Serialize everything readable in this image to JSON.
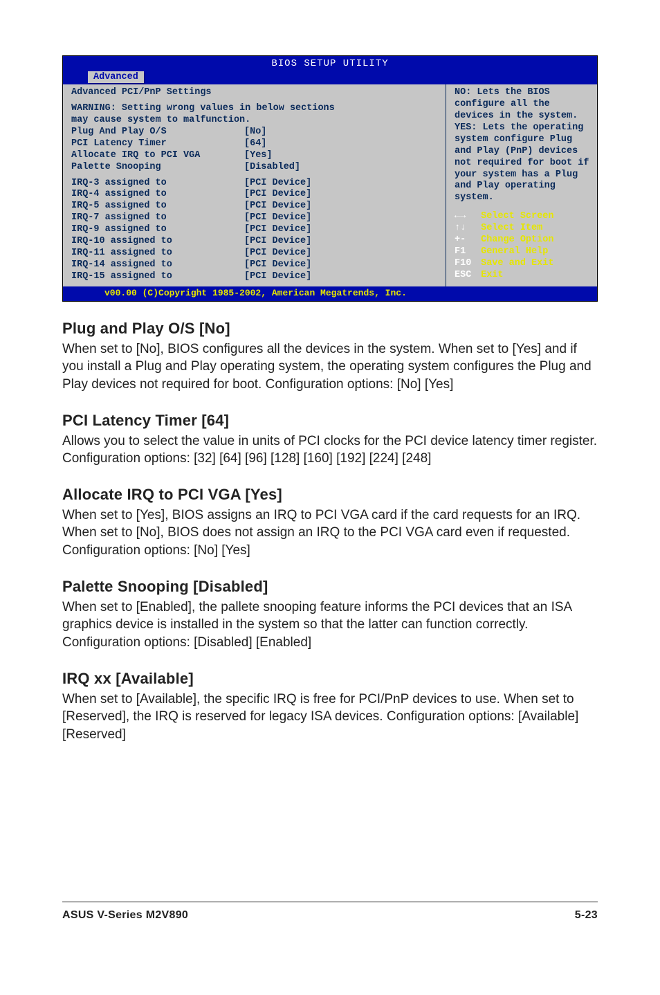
{
  "bios": {
    "title": "BIOS SETUP UTILITY",
    "tab": "Advanced",
    "heading": "Advanced PCI/PnP Settings",
    "warning_line1": "WARNING: Setting wrong values in below sections",
    "warning_line2": "may cause system to malfunction.",
    "settings": [
      {
        "label": "Plug And Play O/S",
        "value": "[No]"
      },
      {
        "label": "PCI Latency Timer",
        "value": "[64]"
      },
      {
        "label": "Allocate IRQ to PCI VGA",
        "value": "[Yes]"
      },
      {
        "label": "Palette Snooping",
        "value": "[Disabled]"
      }
    ],
    "irqs": [
      {
        "label": "IRQ-3 assigned to",
        "value": "[PCI Device]"
      },
      {
        "label": "IRQ-4 assigned to",
        "value": "[PCI Device]"
      },
      {
        "label": "IRQ-5 assigned to",
        "value": "[PCI Device]"
      },
      {
        "label": "IRQ-7 assigned to",
        "value": "[PCI Device]"
      },
      {
        "label": "IRQ-9 assigned to",
        "value": "[PCI Device]"
      },
      {
        "label": "IRQ-10 assigned to",
        "value": "[PCI Device]"
      },
      {
        "label": "IRQ-11 assigned to",
        "value": "[PCI Device]"
      },
      {
        "label": "IRQ-14 assigned to",
        "value": "[PCI Device]"
      },
      {
        "label": "IRQ-15 assigned to",
        "value": "[PCI Device]"
      }
    ],
    "help_text": "NO: Lets the BIOS configure all the devices in the system. YES: Lets the operating system configure Plug and Play (PnP) devices not required for boot if your system has a Plug and Play operating system.",
    "nav": [
      {
        "key": "←→",
        "label": "Select Screen"
      },
      {
        "key": "↑↓",
        "label": "Select Item"
      },
      {
        "key": "+-",
        "label": "Change Option"
      },
      {
        "key": "F1",
        "label": "General Help"
      },
      {
        "key": "F10",
        "label": "Save and Exit"
      },
      {
        "key": "ESC",
        "label": "Exit"
      }
    ],
    "footer": "v00.00 (C)Copyright 1985-2002, American Megatrends, Inc."
  },
  "sections": [
    {
      "heading": "Plug and Play O/S [No]",
      "body": "When set to [No], BIOS configures all the devices in the system. When set to [Yes] and if you install a Plug and Play operating system, the operating system configures the Plug and Play devices not required for boot. Configuration options: [No] [Yes]"
    },
    {
      "heading": "PCI Latency Timer [64]",
      "body": "Allows you to select the value in units of PCI clocks for the PCI device latency timer register. Configuration options: [32] [64] [96] [128] [160] [192] [224] [248]"
    },
    {
      "heading": "Allocate IRQ to PCI VGA [Yes]",
      "body": "When set to [Yes], BIOS assigns an IRQ to PCI VGA card if the card requests for an IRQ. When set to [No], BIOS does not assign an IRQ to the PCI VGA card even if requested. Configuration options: [No] [Yes]"
    },
    {
      "heading": "Palette Snooping [Disabled]",
      "body": "When set to [Enabled], the pallete snooping feature informs the PCI devices that an ISA graphics device is installed in the system so that the latter can function correctly. Configuration options: [Disabled] [Enabled]"
    },
    {
      "heading": "IRQ xx [Available]",
      "body": "When set to [Available], the specific IRQ is free for PCI/PnP devices to use. When set to [Reserved], the IRQ is reserved for legacy ISA devices. Configuration options: [Available] [Reserved]"
    }
  ],
  "footer": {
    "left": "ASUS V-Series M2V890",
    "right": "5-23"
  }
}
